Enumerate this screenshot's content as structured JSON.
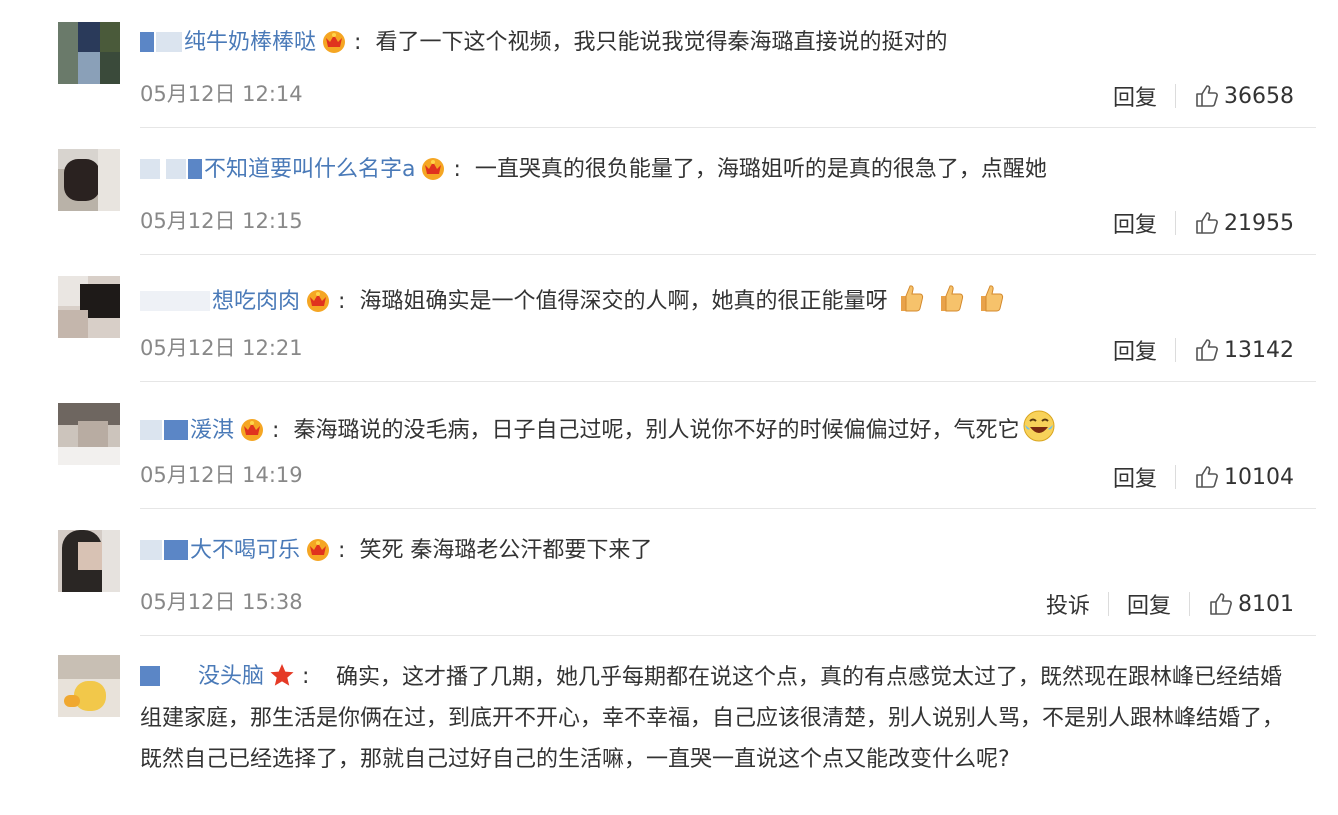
{
  "actions": {
    "report_label": "投诉",
    "reply_label": "回复"
  },
  "comments": [
    {
      "username": "纯牛奶棒棒哒",
      "content": "看了一下这个视频，我只能说我觉得秦海璐直接说的挺对的",
      "time": "05月12日 12:14",
      "likes": "36658"
    },
    {
      "username": "不知道要叫什么名字a",
      "content": "一直哭真的很负能量了，海璐姐听的是真的很急了，点醒她",
      "time": "05月12日 12:15",
      "likes": "21955"
    },
    {
      "username": "想吃肉肉",
      "content": "海璐姐确实是一个值得深交的人啊，她真的很正能量呀",
      "time": "05月12日 12:21",
      "likes": "13142"
    },
    {
      "username": "湲淇",
      "content": "秦海璐说的没毛病，日子自己过呢，别人说你不好的时候偏偏过好，气死它",
      "time": "05月12日 14:19",
      "likes": "10104"
    },
    {
      "username": "大不喝可乐",
      "content": "笑死 秦海璐老公汗都要下来了",
      "time": "05月12日 15:38",
      "likes": "8101"
    },
    {
      "username": "没头脑",
      "content": "确实，这才播了几期，她几乎每期都在说这个点，真的有点感觉太过了，既然现在跟林峰已经结婚组建家庭，那生活是你俩在过，到底开不开心，幸不幸福，自己应该很清楚，别人说别人骂，不是别人跟林峰结婚了，既然自己已经选择了，那就自己过好自己的生活嘛，一直哭一直说这个点又能改变什么呢?"
    }
  ],
  "colors": {
    "username": "#4a7ab8",
    "meta": "#888888",
    "divider": "#e6e6e6",
    "badge": "#f5a623"
  },
  "icons": {
    "crown_badge": "crown-badge-icon",
    "star_badge": "star-badge-icon",
    "like": "thumbs-up-icon",
    "thumbs_emoji": "thumbs-up-emoji",
    "laugh_emoji": "laughing-emoji"
  }
}
